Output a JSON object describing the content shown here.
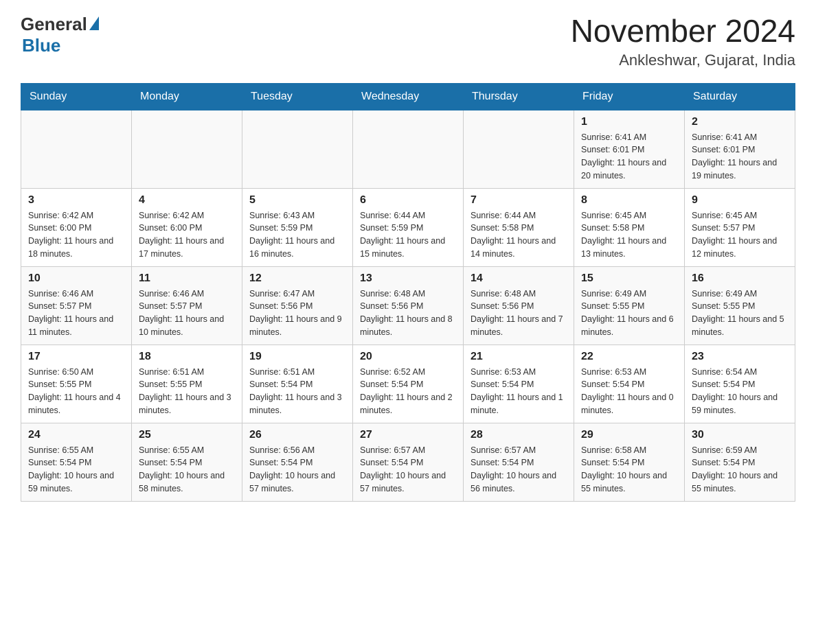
{
  "header": {
    "logo_general": "General",
    "logo_blue": "Blue",
    "month_title": "November 2024",
    "location": "Ankleshwar, Gujarat, India"
  },
  "days_of_week": [
    "Sunday",
    "Monday",
    "Tuesday",
    "Wednesday",
    "Thursday",
    "Friday",
    "Saturday"
  ],
  "weeks": [
    [
      {
        "day": "",
        "sunrise": "",
        "sunset": "",
        "daylight": ""
      },
      {
        "day": "",
        "sunrise": "",
        "sunset": "",
        "daylight": ""
      },
      {
        "day": "",
        "sunrise": "",
        "sunset": "",
        "daylight": ""
      },
      {
        "day": "",
        "sunrise": "",
        "sunset": "",
        "daylight": ""
      },
      {
        "day": "",
        "sunrise": "",
        "sunset": "",
        "daylight": ""
      },
      {
        "day": "1",
        "sunrise": "Sunrise: 6:41 AM",
        "sunset": "Sunset: 6:01 PM",
        "daylight": "Daylight: 11 hours and 20 minutes."
      },
      {
        "day": "2",
        "sunrise": "Sunrise: 6:41 AM",
        "sunset": "Sunset: 6:01 PM",
        "daylight": "Daylight: 11 hours and 19 minutes."
      }
    ],
    [
      {
        "day": "3",
        "sunrise": "Sunrise: 6:42 AM",
        "sunset": "Sunset: 6:00 PM",
        "daylight": "Daylight: 11 hours and 18 minutes."
      },
      {
        "day": "4",
        "sunrise": "Sunrise: 6:42 AM",
        "sunset": "Sunset: 6:00 PM",
        "daylight": "Daylight: 11 hours and 17 minutes."
      },
      {
        "day": "5",
        "sunrise": "Sunrise: 6:43 AM",
        "sunset": "Sunset: 5:59 PM",
        "daylight": "Daylight: 11 hours and 16 minutes."
      },
      {
        "day": "6",
        "sunrise": "Sunrise: 6:44 AM",
        "sunset": "Sunset: 5:59 PM",
        "daylight": "Daylight: 11 hours and 15 minutes."
      },
      {
        "day": "7",
        "sunrise": "Sunrise: 6:44 AM",
        "sunset": "Sunset: 5:58 PM",
        "daylight": "Daylight: 11 hours and 14 minutes."
      },
      {
        "day": "8",
        "sunrise": "Sunrise: 6:45 AM",
        "sunset": "Sunset: 5:58 PM",
        "daylight": "Daylight: 11 hours and 13 minutes."
      },
      {
        "day": "9",
        "sunrise": "Sunrise: 6:45 AM",
        "sunset": "Sunset: 5:57 PM",
        "daylight": "Daylight: 11 hours and 12 minutes."
      }
    ],
    [
      {
        "day": "10",
        "sunrise": "Sunrise: 6:46 AM",
        "sunset": "Sunset: 5:57 PM",
        "daylight": "Daylight: 11 hours and 11 minutes."
      },
      {
        "day": "11",
        "sunrise": "Sunrise: 6:46 AM",
        "sunset": "Sunset: 5:57 PM",
        "daylight": "Daylight: 11 hours and 10 minutes."
      },
      {
        "day": "12",
        "sunrise": "Sunrise: 6:47 AM",
        "sunset": "Sunset: 5:56 PM",
        "daylight": "Daylight: 11 hours and 9 minutes."
      },
      {
        "day": "13",
        "sunrise": "Sunrise: 6:48 AM",
        "sunset": "Sunset: 5:56 PM",
        "daylight": "Daylight: 11 hours and 8 minutes."
      },
      {
        "day": "14",
        "sunrise": "Sunrise: 6:48 AM",
        "sunset": "Sunset: 5:56 PM",
        "daylight": "Daylight: 11 hours and 7 minutes."
      },
      {
        "day": "15",
        "sunrise": "Sunrise: 6:49 AM",
        "sunset": "Sunset: 5:55 PM",
        "daylight": "Daylight: 11 hours and 6 minutes."
      },
      {
        "day": "16",
        "sunrise": "Sunrise: 6:49 AM",
        "sunset": "Sunset: 5:55 PM",
        "daylight": "Daylight: 11 hours and 5 minutes."
      }
    ],
    [
      {
        "day": "17",
        "sunrise": "Sunrise: 6:50 AM",
        "sunset": "Sunset: 5:55 PM",
        "daylight": "Daylight: 11 hours and 4 minutes."
      },
      {
        "day": "18",
        "sunrise": "Sunrise: 6:51 AM",
        "sunset": "Sunset: 5:55 PM",
        "daylight": "Daylight: 11 hours and 3 minutes."
      },
      {
        "day": "19",
        "sunrise": "Sunrise: 6:51 AM",
        "sunset": "Sunset: 5:54 PM",
        "daylight": "Daylight: 11 hours and 3 minutes."
      },
      {
        "day": "20",
        "sunrise": "Sunrise: 6:52 AM",
        "sunset": "Sunset: 5:54 PM",
        "daylight": "Daylight: 11 hours and 2 minutes."
      },
      {
        "day": "21",
        "sunrise": "Sunrise: 6:53 AM",
        "sunset": "Sunset: 5:54 PM",
        "daylight": "Daylight: 11 hours and 1 minute."
      },
      {
        "day": "22",
        "sunrise": "Sunrise: 6:53 AM",
        "sunset": "Sunset: 5:54 PM",
        "daylight": "Daylight: 11 hours and 0 minutes."
      },
      {
        "day": "23",
        "sunrise": "Sunrise: 6:54 AM",
        "sunset": "Sunset: 5:54 PM",
        "daylight": "Daylight: 10 hours and 59 minutes."
      }
    ],
    [
      {
        "day": "24",
        "sunrise": "Sunrise: 6:55 AM",
        "sunset": "Sunset: 5:54 PM",
        "daylight": "Daylight: 10 hours and 59 minutes."
      },
      {
        "day": "25",
        "sunrise": "Sunrise: 6:55 AM",
        "sunset": "Sunset: 5:54 PM",
        "daylight": "Daylight: 10 hours and 58 minutes."
      },
      {
        "day": "26",
        "sunrise": "Sunrise: 6:56 AM",
        "sunset": "Sunset: 5:54 PM",
        "daylight": "Daylight: 10 hours and 57 minutes."
      },
      {
        "day": "27",
        "sunrise": "Sunrise: 6:57 AM",
        "sunset": "Sunset: 5:54 PM",
        "daylight": "Daylight: 10 hours and 57 minutes."
      },
      {
        "day": "28",
        "sunrise": "Sunrise: 6:57 AM",
        "sunset": "Sunset: 5:54 PM",
        "daylight": "Daylight: 10 hours and 56 minutes."
      },
      {
        "day": "29",
        "sunrise": "Sunrise: 6:58 AM",
        "sunset": "Sunset: 5:54 PM",
        "daylight": "Daylight: 10 hours and 55 minutes."
      },
      {
        "day": "30",
        "sunrise": "Sunrise: 6:59 AM",
        "sunset": "Sunset: 5:54 PM",
        "daylight": "Daylight: 10 hours and 55 minutes."
      }
    ]
  ]
}
